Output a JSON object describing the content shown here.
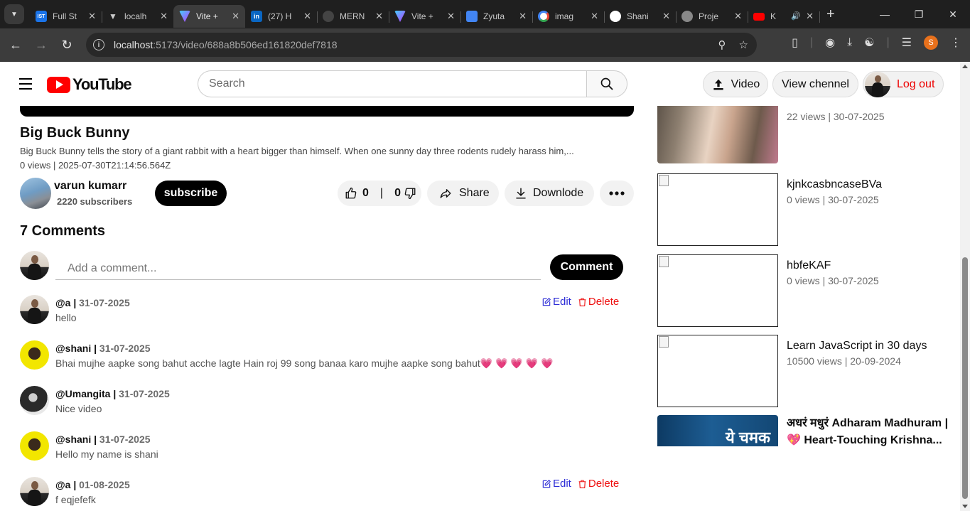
{
  "browser": {
    "tabs": [
      {
        "title": "Full St",
        "icon": "ist-icon",
        "color": "#1a73e8"
      },
      {
        "title": "localh",
        "icon": "vercel-icon",
        "color": "#555555"
      },
      {
        "title": "Vite +",
        "icon": "vite-icon",
        "color": "#9b59ff"
      },
      {
        "title": "(27) H",
        "icon": "linkedin-icon",
        "color": "#0a66c2"
      },
      {
        "title": "MERN",
        "icon": "chatgpt-icon",
        "color": "#444444"
      },
      {
        "title": "Vite +",
        "icon": "vite-icon",
        "color": "#9b59ff"
      },
      {
        "title": "Zyuta",
        "icon": "docs-icon",
        "color": "#4285f4"
      },
      {
        "title": "imag",
        "icon": "google-icon",
        "color": "#ffffff"
      },
      {
        "title": "Shani",
        "icon": "github-icon",
        "color": "#ffffff"
      },
      {
        "title": "Proje",
        "icon": "globe-icon",
        "color": "#888888"
      },
      {
        "title": "K",
        "icon": "youtube-icon",
        "color": "#ff0000"
      }
    ],
    "url_host": "localhost",
    "url_path": ":5173/video/688a8b506ed161820def7818",
    "profile_letter": "S"
  },
  "header": {
    "logo_text": "YouTube",
    "search_placeholder": "Search",
    "video_btn": "Video",
    "channel_btn": "View chennel",
    "logout_btn": "Log out"
  },
  "video": {
    "title": "Big Buck Bunny",
    "description": "Big Buck Bunny tells the story of a giant rabbit with a heart bigger than himself. When one sunny day three rodents rudely harass him,...",
    "meta": "0 views | 2025-07-30T21:14:56.564Z",
    "channel_name": "varun kumarr",
    "subscribers": "2220 subscribers",
    "subscribe_label": "subscribe",
    "likes": "0",
    "sep": "|",
    "dislikes": "0",
    "share_label": "Share",
    "download_label": "Downlode"
  },
  "comments": {
    "count_label": "7 Comments",
    "input_placeholder": "Add a comment...",
    "button_label": "Comment",
    "edit_label": "Edit",
    "delete_label": "Delete",
    "items": [
      {
        "user": "@a |",
        "date": "31-07-2025",
        "text": "hello",
        "owned": true
      },
      {
        "user": "@shani |",
        "date": "31-07-2025",
        "text": "Bhai mujhe aapke song bahut acche lagte Hain roj 99 song banaa karo mujhe aapke song bahut💗 💗 💗 💗 💗",
        "owned": false
      },
      {
        "user": "@Umangita |",
        "date": "31-07-2025",
        "text": "Nice video",
        "owned": false
      },
      {
        "user": "@shani |",
        "date": "31-07-2025",
        "text": "Hello my name is shani",
        "owned": false
      },
      {
        "user": "@a |",
        "date": "01-08-2025",
        "text": "f eqjefefk",
        "owned": true
      }
    ]
  },
  "sidebar": {
    "items": [
      {
        "title": "",
        "meta": "22 views | 30-07-2025"
      },
      {
        "title": "kjnkcasbncaseBVa",
        "meta": "0 views | 30-07-2025"
      },
      {
        "title": "hbfeKAF",
        "meta": "0 views | 30-07-2025"
      },
      {
        "title": "Learn JavaScript in 30 days",
        "meta": "10500 views | 20-09-2024"
      },
      {
        "title": "अधरं मधुरं Adharam Madhuram | 💖 Heart-Touching Krishna...",
        "thumb_text": "ये चमक"
      }
    ]
  }
}
